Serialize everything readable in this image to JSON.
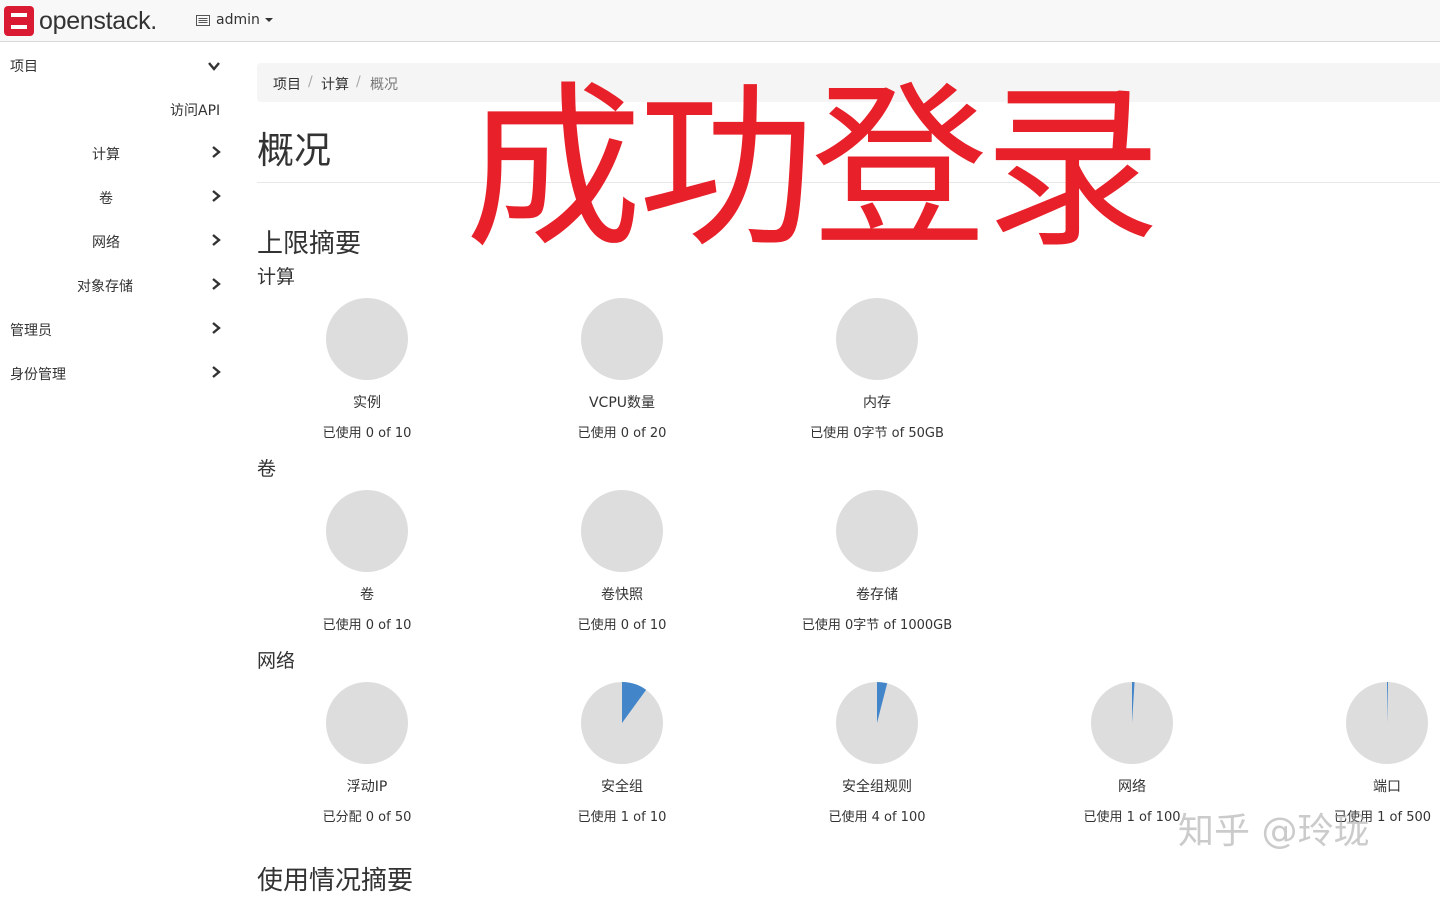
{
  "brand": {
    "name": "openstack."
  },
  "header": {
    "project": "admin",
    "menu_icon": "list-icon",
    "caret_icon": "caret-down-icon"
  },
  "sidebar": {
    "items": [
      {
        "label": "项目",
        "icon": "chevron-down-icon"
      },
      {
        "label": "访问API"
      },
      {
        "label": "计算",
        "icon": "chevron-right-icon"
      },
      {
        "label": "卷",
        "icon": "chevron-right-icon"
      },
      {
        "label": "网络",
        "icon": "chevron-right-icon"
      },
      {
        "label": "对象存储",
        "icon": "chevron-right-icon"
      },
      {
        "label": "管理员",
        "icon": "chevron-right-icon"
      },
      {
        "label": "身份管理",
        "icon": "chevron-right-icon"
      }
    ]
  },
  "breadcrumb": {
    "items": [
      "项目",
      "计算",
      "概况"
    ],
    "separator": "/"
  },
  "page": {
    "title": "概况",
    "overlay": "成功登录",
    "watermark": "知乎 @玲珑"
  },
  "limits": {
    "title": "上限摘要",
    "groups": [
      {
        "title": "计算",
        "charts": [
          {
            "label": "实例",
            "used": "已使用 0 of 10",
            "fraction": 0
          },
          {
            "label": "VCPU数量",
            "used": "已使用 0 of 20",
            "fraction": 0
          },
          {
            "label": "内存",
            "used": "已使用 0字节 of 50GB",
            "fraction": 0
          }
        ]
      },
      {
        "title": "卷",
        "charts": [
          {
            "label": "卷",
            "used": "已使用 0 of 10",
            "fraction": 0
          },
          {
            "label": "卷快照",
            "used": "已使用 0 of 10",
            "fraction": 0
          },
          {
            "label": "卷存储",
            "used": "已使用 0字节 of 1000GB",
            "fraction": 0
          }
        ]
      },
      {
        "title": "网络",
        "charts": [
          {
            "label": "浮动IP",
            "used": "已分配 0 of 50",
            "fraction": 0
          },
          {
            "label": "安全组",
            "used": "已使用 1 of 10",
            "fraction": 0.1
          },
          {
            "label": "安全组规则",
            "used": "已使用 4 of 100",
            "fraction": 0.04
          },
          {
            "label": "网络",
            "used": "已使用 1 of 100",
            "fraction": 0.01
          },
          {
            "label": "端口",
            "used": "已使用 1 of 500",
            "fraction": 0.002
          }
        ]
      }
    ]
  },
  "usage": {
    "title": "使用情况摘要"
  },
  "colors": {
    "pie_bg": "#dddddd",
    "pie_fill": "#4285c9",
    "overlay": "#e8202a",
    "brand_red": "#da1a32"
  }
}
